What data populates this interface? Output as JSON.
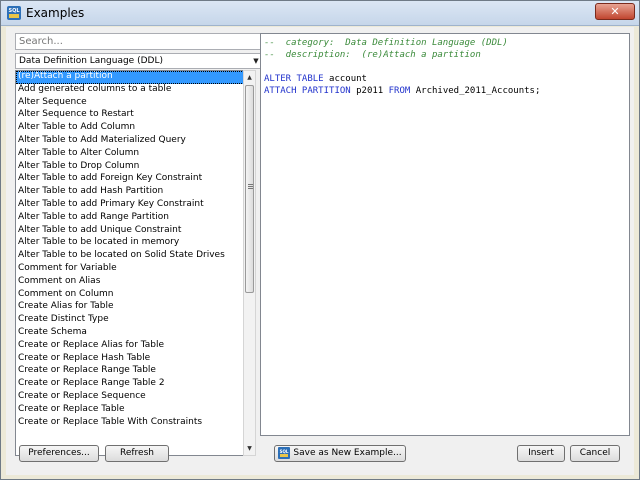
{
  "window": {
    "title": "Examples",
    "close_symbol": "✕"
  },
  "search": {
    "placeholder": "Search..."
  },
  "category": {
    "value": "Data Definition Language (DDL)"
  },
  "examples": [
    "(re)Attach a partition",
    "Add generated columns to a table",
    "Alter Sequence",
    "Alter Sequence to Restart",
    "Alter Table to Add Column",
    "Alter Table to Add Materialized Query",
    "Alter Table to Alter Column",
    "Alter Table to Drop Column",
    "Alter Table to add Foreign Key Constraint",
    "Alter Table to add Hash Partition",
    "Alter Table to add Primary Key Constraint",
    "Alter Table to add Range Partition",
    "Alter Table to add Unique Constraint",
    "Alter Table to be located in memory",
    "Alter Table to be located on Solid State Drives",
    "Comment for Variable",
    "Comment on Alias",
    "Comment on Column",
    "Create Alias for Table",
    "Create Distinct Type",
    "Create Schema",
    "Create or Replace Alias for Table",
    "Create or Replace Hash Table",
    "Create or Replace Range Table",
    "Create or Replace Range Table 2",
    "Create or Replace Sequence",
    "Create or Replace Table",
    "Create or Replace Table With Constraints"
  ],
  "selected_index": 0,
  "editor": {
    "comment1": "--  category:  Data Definition Language (DDL)",
    "comment2": "--  description:  (re)Attach a partition",
    "line1_kw": "ALTER TABLE",
    "line1_txt": " account",
    "line2_kw1": "ATTACH PARTITION",
    "line2_txt1": " p2011 ",
    "line2_kw2": "FROM",
    "line2_txt2": " Archived_2011_Accounts;"
  },
  "buttons": {
    "preferences": "Preferences...",
    "refresh": "Refresh",
    "save_new": "Save as New Example...",
    "insert": "Insert",
    "cancel": "Cancel"
  },
  "colors": {
    "selection": "#3399ff",
    "comment": "#3a8a3a",
    "keyword": "#2233cc"
  }
}
